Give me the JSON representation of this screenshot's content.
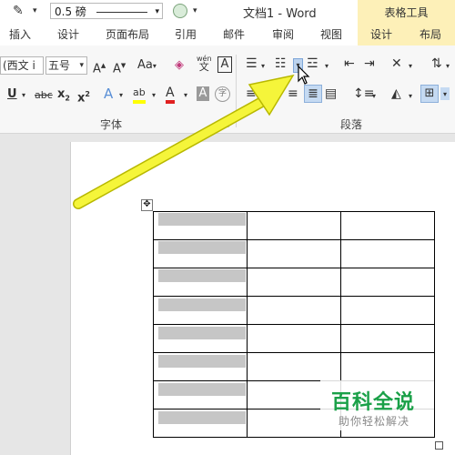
{
  "title_bar": {
    "doc_title": "文档1 - Word",
    "context_group_title": "表格工具",
    "line_weight": "0.5 磅"
  },
  "tabs": [
    "插入",
    "设计",
    "页面布局",
    "引用",
    "邮件",
    "审阅",
    "视图"
  ],
  "context_tabs": [
    "设计",
    "布局"
  ],
  "font_group": {
    "font_name": "(西文 i",
    "font_size": "五号",
    "label": "字体",
    "phonetic_glyph": "wén",
    "phonetic_char": "文"
  },
  "paragraph_group": {
    "label": "段落"
  },
  "table": {
    "rows": 8,
    "cols": 3
  },
  "watermark": {
    "title": "百科全说",
    "subtitle": "助你轻松解决"
  },
  "colors": {
    "context_tab_bg": "#fdf0b8",
    "arrow": "#f5f53a",
    "shade": "#c6c6c6",
    "watermark_green": "#1aa048"
  }
}
